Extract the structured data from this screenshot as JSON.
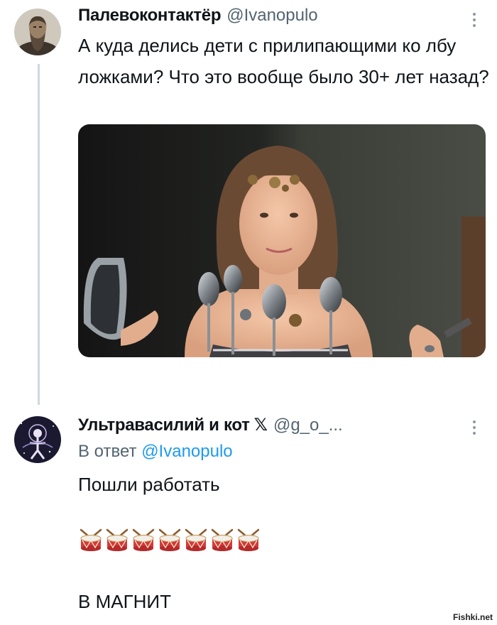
{
  "tweet": {
    "author_name": "Палевоконтактёр",
    "author_handle": "@Ivanopulo",
    "text": "А куда делись дети с прилипающими ко лбу ложками? Что это вообще было 30+ лет назад?",
    "avatar_icon": "bearded-man-avatar",
    "photo_icon": "girl-with-spoons-photo"
  },
  "reply": {
    "author_name": "Ультравасилий и кот",
    "badge": "𝕏",
    "author_handle": "@g_o_...",
    "reply_prefix": "В ответ",
    "reply_to": "@Ivanopulo",
    "line1": "Пошли работать",
    "drum_count": 7,
    "drum_icon": "drum-icon",
    "line3": "В МАГНИТ",
    "avatar_icon": "cosmic-figure-avatar"
  },
  "watermark": "Fishki.net",
  "colors": {
    "text": "#0f1419",
    "secondary": "#536471",
    "link": "#1d9bf0",
    "thread_line": "#cfd9de"
  }
}
